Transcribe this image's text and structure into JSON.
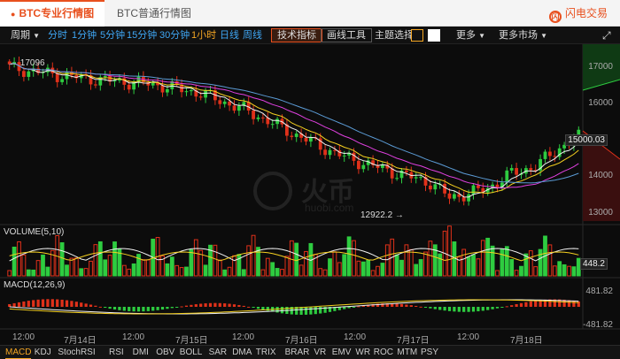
{
  "tabs": [
    {
      "label": "BTC专业行情图",
      "active": true
    },
    {
      "label": "BTC普通行情图",
      "active": false
    }
  ],
  "brand": {
    "name": "闪电交易",
    "logo_char": "闪"
  },
  "toolbar": {
    "period_label": "周期",
    "periods": [
      "分时",
      "1分钟",
      "5分钟",
      "15分钟",
      "30分钟",
      "1小时",
      "日线",
      "周线"
    ],
    "active_period": "1小时",
    "tech_label": "技术指标",
    "draw_label": "画线工具",
    "theme_label": "主题选择",
    "more_label": "更多",
    "markets_label": "更多市场"
  },
  "chart_data": {
    "type": "candlestick",
    "price_axis": [
      "17000",
      "16000",
      "15000",
      "14000",
      "13000"
    ],
    "ylim": [
      12700,
      17300
    ],
    "high_label": "17096",
    "low_label": "12922.2",
    "last_price": "15000.03",
    "volume_title": "VOLUME(5,10)",
    "volume_last": "448.2",
    "macd_title": "MACD(12,26,9)",
    "macd_axis": [
      "481.82",
      "-481.82"
    ],
    "x_labels": [
      "12:00",
      "7月14日",
      "12:00",
      "7月15日",
      "12:00",
      "7月16日",
      "12:00",
      "7月17日",
      "12:00",
      "7月18日"
    ],
    "colors": {
      "up": "#2ecc40",
      "down": "#e0311a",
      "ma1": "#f2f2f2",
      "ma2": "#f5d020",
      "ma3": "#e040e0",
      "ma4": "#5b9bd5"
    }
  },
  "watermark": {
    "brand": "火币",
    "url": "huobi.com"
  },
  "indicators": [
    "MACD",
    "KDJ",
    "StochRSI",
    "RSI",
    "DMI",
    "OBV",
    "BOLL",
    "SAR",
    "DMA",
    "TRIX",
    "BRAR",
    "VR",
    "EMV",
    "WR",
    "ROC",
    "MTM",
    "PSY"
  ],
  "active_indicator": "MACD"
}
